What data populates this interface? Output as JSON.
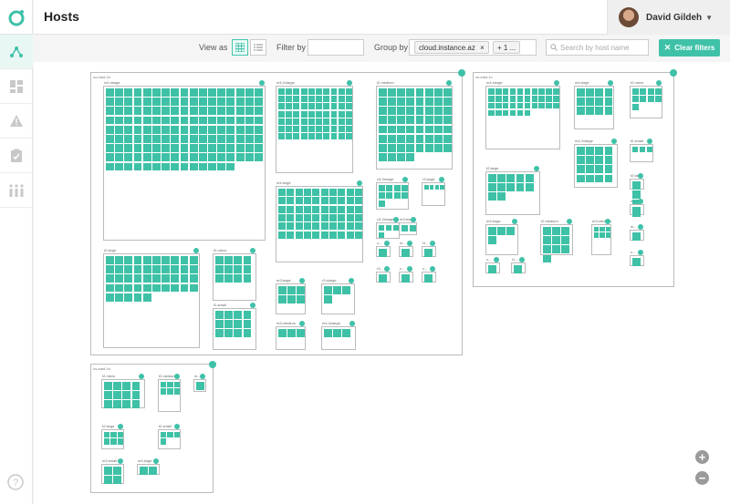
{
  "header": {
    "title": "Hosts"
  },
  "user": {
    "name": "David Gildeh"
  },
  "sidebar": {
    "items": [
      "topology-icon",
      "dashboard-icon",
      "alert-icon",
      "checklist-icon",
      "hosts-icon"
    ]
  },
  "toolbar": {
    "view_as_label": "View as",
    "filter_by_label": "Filter by",
    "filter_placeholder": "",
    "group_by_label": "Group by",
    "group_chip": "cloud.instance.az",
    "group_chip_remove": "×",
    "more_chip": "+ 1 ...",
    "search_placeholder": "Search by host name",
    "clear_filters": "Clear filters"
  },
  "colors": {
    "accent": "#3fc1a8",
    "host": "#3ec1a6"
  },
  "map": {
    "groups": [
      {
        "label": "us-east-1b",
        "clusters": [
          {
            "label": "m4.xlarge",
            "count": 150
          },
          {
            "label": "m4.2xlarge",
            "count": 70
          },
          {
            "label": "t2.medium",
            "count": 60
          },
          {
            "label": "m4.large",
            "count": 60
          },
          {
            "label": "c3.2xlarge",
            "count": 9
          },
          {
            "label": "r3.large",
            "count": 4
          },
          {
            "label": "c3.2xlarge",
            "count": 4
          },
          {
            "label": "m3.large",
            "count": 2
          },
          {
            "label": "t2.large",
            "count": 45
          },
          {
            "label": "t2.micro",
            "count": 12
          },
          {
            "label": "t2.small",
            "count": 12
          },
          {
            "label": "r3.xlarge",
            "count": 4
          },
          {
            "label": "m3.large",
            "count": 6
          },
          {
            "label": "m3.medium",
            "count": 3
          },
          {
            "label": "m4.4xlarge",
            "count": 3
          },
          {
            "label": "c...",
            "count": 1
          },
          {
            "label": "m...",
            "count": 1
          },
          {
            "label": "r3...",
            "count": 1
          },
          {
            "label": "c...",
            "count": 1
          },
          {
            "label": "t1...",
            "count": 1
          },
          {
            "label": "c...",
            "count": 1
          }
        ]
      },
      {
        "label": "us-east-1c",
        "clusters": [
          {
            "label": "m4.xlarge",
            "count": 36
          },
          {
            "label": "m4.large",
            "count": 12
          },
          {
            "label": "t2.micro",
            "count": 9
          },
          {
            "label": "m4.2xlarge",
            "count": 16
          },
          {
            "label": "t2.small",
            "count": 3
          },
          {
            "label": "m3.large",
            "count": 4
          },
          {
            "label": "t2.large",
            "count": 12
          },
          {
            "label": "t2.medium",
            "count": 10
          },
          {
            "label": "m3.medium",
            "count": 6
          },
          {
            "label": "t2.large",
            "count": 4
          },
          {
            "label": "c...",
            "count": 1
          },
          {
            "label": "m...",
            "count": 1
          },
          {
            "label": "c...",
            "count": 1
          },
          {
            "label": "t1...",
            "count": 1
          },
          {
            "label": "c...",
            "count": 1
          }
        ]
      },
      {
        "label": "us-east-1e",
        "clusters": [
          {
            "label": "t2.micro",
            "count": 12
          },
          {
            "label": "t2.medium",
            "count": 6
          },
          {
            "label": "m...",
            "count": 1
          },
          {
            "label": "t2.large",
            "count": 6
          },
          {
            "label": "t2.small",
            "count": 4
          },
          {
            "label": "m3.small",
            "count": 4
          },
          {
            "label": "m4.large",
            "count": 2
          }
        ]
      }
    ]
  }
}
